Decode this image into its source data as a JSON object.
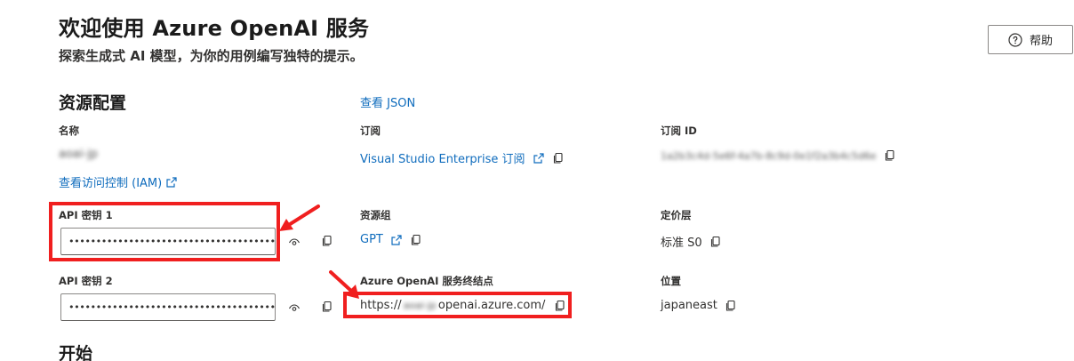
{
  "header": {
    "title": "欢迎使用 Azure OpenAI 服务",
    "subtitle": "探索生成式 AI 模型，为你的用例编写独特的提示。",
    "help_label": "帮助"
  },
  "resource": {
    "section_title": "资源配置",
    "view_json": "查看 JSON",
    "name_label": "名称",
    "name_value": "aoai-jp",
    "iam_link": "查看访问控制 (IAM)",
    "subscription_label": "订阅",
    "subscription_value": "Visual Studio Enterprise 订阅",
    "subscription_id_label": "订阅 ID",
    "subscription_id_value": "1a2b3c4d-5e6f-4a7b-8c9d-0e1f2a3b4c5d6e",
    "api_key1_label": "API 密钥 1",
    "api_key1_value": "••••••••••••••••••••••••••••••••••••••••••",
    "api_key2_label": "API 密钥 2",
    "api_key2_value": "••••••••••••••••••••••••••••••••••••••••••",
    "resource_group_label": "资源组",
    "resource_group_value": "GPT",
    "pricing_tier_label": "定价层",
    "pricing_tier_value": "标准 S0",
    "endpoint_label": "Azure OpenAI 服务终结点",
    "endpoint_prefix": "https://",
    "endpoint_blur": "aoai-jp",
    "endpoint_suffix": "openai.azure.com/",
    "location_label": "位置",
    "location_value": "japaneast"
  },
  "getting_started": {
    "section_title": "开始"
  },
  "colors": {
    "link": "#0f6cbd",
    "highlight": "#f01f1f"
  }
}
